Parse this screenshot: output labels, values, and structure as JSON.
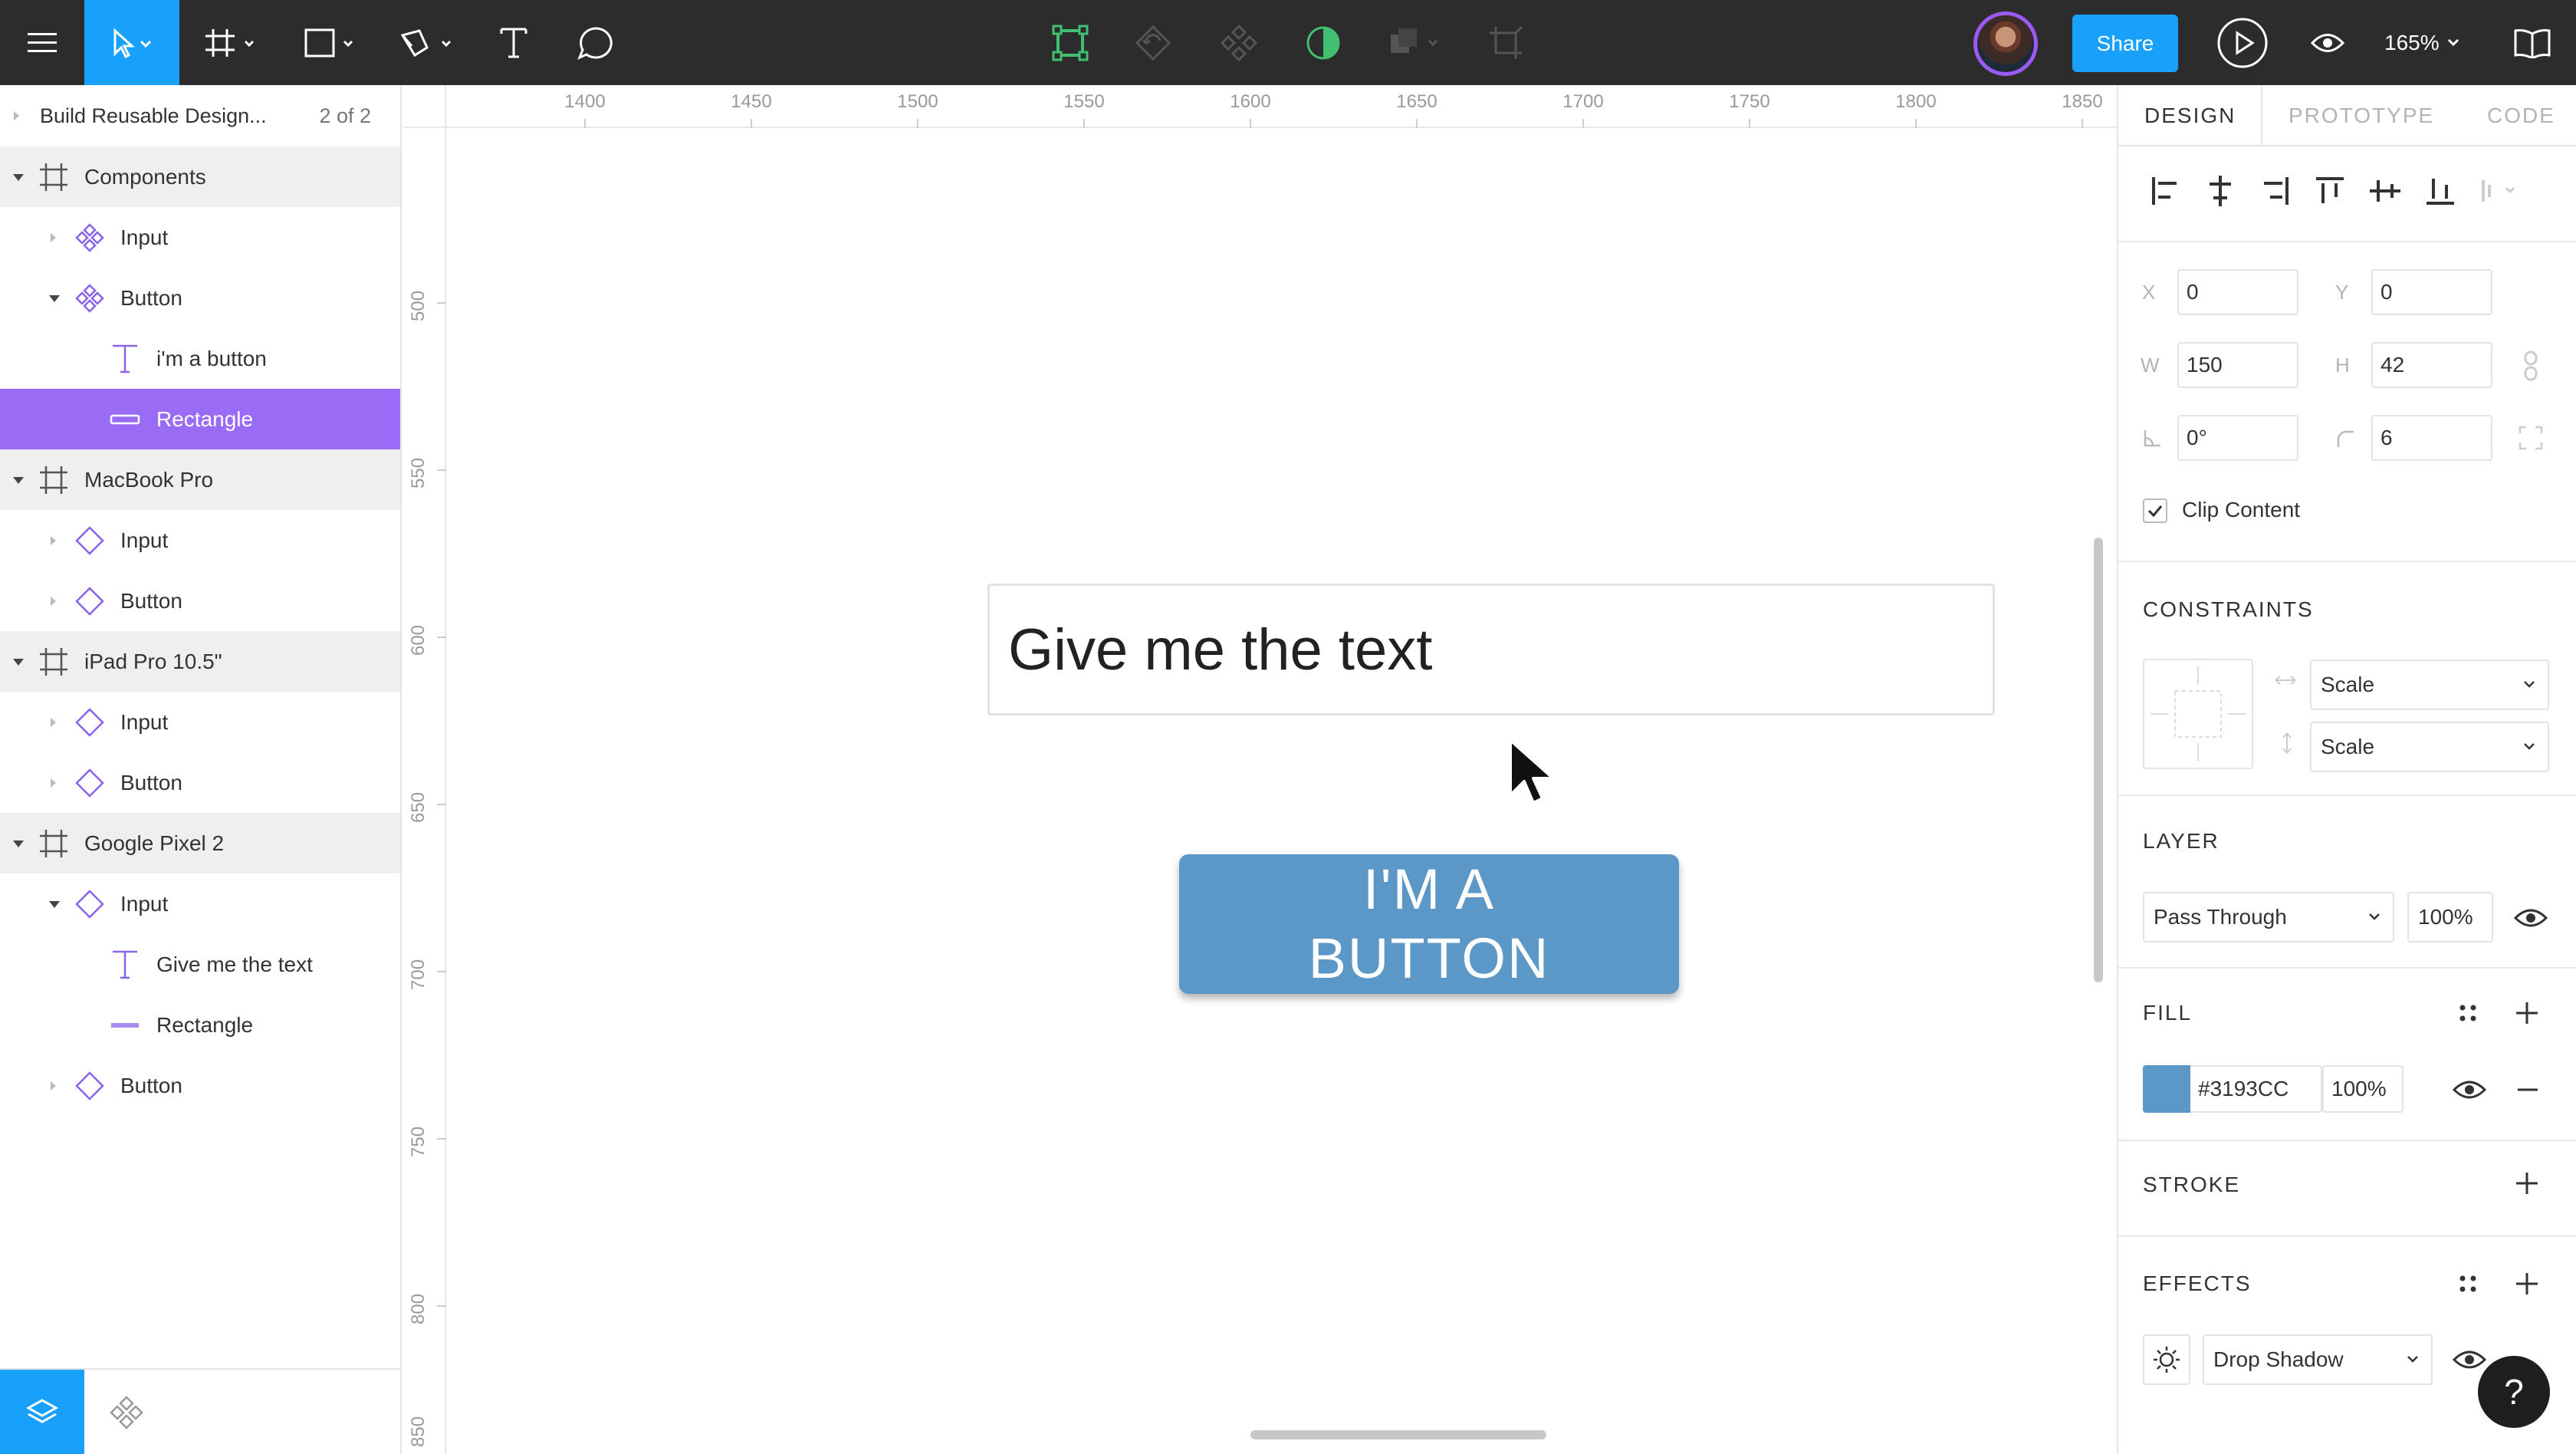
{
  "toolbar": {
    "share_label": "Share",
    "zoom": "165%",
    "accent_color": "#18a0fb"
  },
  "left_panel": {
    "page_name": "Build Reusable Design...",
    "page_count": "2 of 2",
    "layers": [
      {
        "name": "Components",
        "type": "frame"
      },
      {
        "name": "Input",
        "type": "component"
      },
      {
        "name": "Button",
        "type": "component"
      },
      {
        "name": "i'm a button",
        "type": "text"
      },
      {
        "name": "Rectangle",
        "type": "rectangle",
        "selected": true
      },
      {
        "name": "MacBook Pro",
        "type": "frame"
      },
      {
        "name": "Input",
        "type": "instance"
      },
      {
        "name": "Button",
        "type": "instance"
      },
      {
        "name": "iPad Pro 10.5\"",
        "type": "frame"
      },
      {
        "name": "Input",
        "type": "instance"
      },
      {
        "name": "Button",
        "type": "instance"
      },
      {
        "name": "Google Pixel 2",
        "type": "frame"
      },
      {
        "name": "Input",
        "type": "instance"
      },
      {
        "name": "Give me the text",
        "type": "text"
      },
      {
        "name": "Rectangle",
        "type": "rectangle"
      },
      {
        "name": "Button",
        "type": "instance"
      }
    ]
  },
  "canvas": {
    "ruler_top": [
      "1400",
      "1450",
      "1500",
      "1550",
      "1600",
      "1650",
      "1700",
      "1750",
      "1800",
      "1850"
    ],
    "ruler_left": [
      "500",
      "550",
      "600",
      "650",
      "700",
      "750",
      "800",
      "850"
    ],
    "input_text": "Give me the text",
    "button_text": "I'M A BUTTON"
  },
  "right_panel": {
    "tabs": [
      "DESIGN",
      "PROTOTYPE",
      "CODE"
    ],
    "x_label": "X",
    "x_value": "0",
    "y_label": "Y",
    "y_value": "0",
    "w_label": "W",
    "w_value": "150",
    "h_label": "H",
    "h_value": "42",
    "rotation_value": "0°",
    "radius_value": "6",
    "clip_content_label": "Clip Content",
    "clip_content_checked": true,
    "constraints_title": "CONSTRAINTS",
    "constraint_h": "Scale",
    "constraint_v": "Scale",
    "layer_title": "LAYER",
    "blend_mode": "Pass Through",
    "layer_opacity": "100%",
    "fill_title": "FILL",
    "fill_hex": "#3193CC",
    "fill_opacity": "100%",
    "fill_color": "#5b97c7",
    "stroke_title": "STROKE",
    "effects_title": "EFFECTS",
    "effect_type": "Drop Shadow",
    "help_label": "?"
  }
}
